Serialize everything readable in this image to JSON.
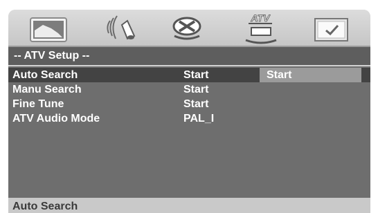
{
  "icons": [
    {
      "name": "picture-icon"
    },
    {
      "name": "audio-icon"
    },
    {
      "name": "video-reel-icon"
    },
    {
      "name": "atv-icon",
      "label": "ATV"
    },
    {
      "name": "preference-icon"
    }
  ],
  "section": {
    "title": "-- ATV Setup --"
  },
  "menu": [
    {
      "label": "Auto Search",
      "value": "Start"
    },
    {
      "label": "Manu Search",
      "value": "Start"
    },
    {
      "label": "Fine Tune",
      "value": "Start"
    },
    {
      "label": "ATV Audio Mode",
      "value": "PAL_I"
    }
  ],
  "selected_option": "Start",
  "status": {
    "text": "Auto Search"
  },
  "colors": {
    "panel": "#d1d1d1",
    "content": "#6e6e6e",
    "highlight": "#434343",
    "option": "#9b9b9b"
  }
}
